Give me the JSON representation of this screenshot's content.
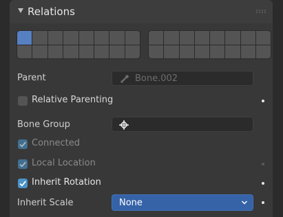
{
  "panel": {
    "title": "Relations",
    "layers": {
      "group_a_active": [
        0
      ],
      "group_b_active": []
    },
    "parent": {
      "label": "Parent",
      "value": "Bone.002",
      "icon": "bone-icon"
    },
    "relative_parenting": {
      "label": "Relative Parenting",
      "checked": false
    },
    "bone_group": {
      "label": "Bone Group",
      "value": "",
      "icon": "bone-group-icon"
    },
    "connected": {
      "label": "Connected",
      "checked": true,
      "enabled": false
    },
    "local_location": {
      "label": "Local Location",
      "checked": true,
      "enabled": false
    },
    "inherit_rotation": {
      "label": "Inherit Rotation",
      "checked": true
    },
    "inherit_scale": {
      "label": "Inherit Scale",
      "value": "None"
    }
  },
  "colors": {
    "active_layer": "#5680c2",
    "checkbox_on": "#4b93c9",
    "select_bg": "#3663a8"
  }
}
